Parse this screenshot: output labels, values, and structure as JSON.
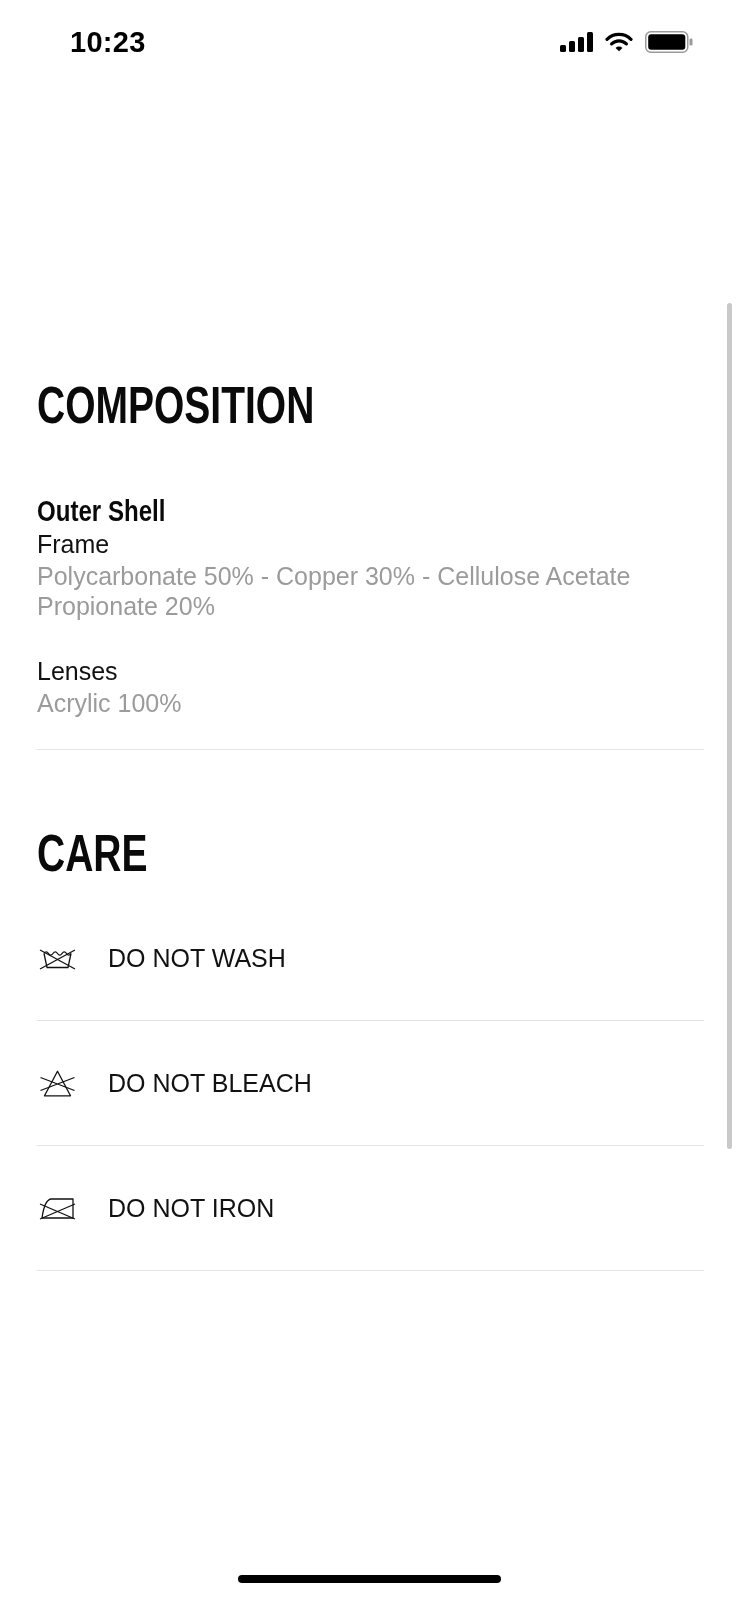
{
  "status_bar": {
    "time": "10:23"
  },
  "composition": {
    "title": "COMPOSITION",
    "groups": [
      {
        "heading": "Outer Shell",
        "parts": [
          {
            "name": "Frame",
            "materials": "Polycarbonate 50% - Copper 30% - Cellulose Acetate Propionate 20%"
          },
          {
            "name": "Lenses",
            "materials": "Acrylic 100%"
          }
        ]
      }
    ]
  },
  "care": {
    "title": "CARE",
    "items": [
      {
        "kind": "wash",
        "label": "DO NOT WASH"
      },
      {
        "kind": "bleach",
        "label": "DO NOT BLEACH"
      },
      {
        "kind": "iron",
        "label": "DO NOT IRON"
      }
    ]
  }
}
